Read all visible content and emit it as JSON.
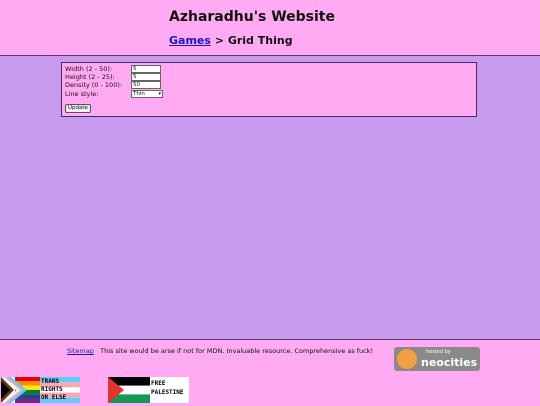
{
  "header": {
    "site_title": "Azharadhu's Website",
    "breadcrumb": {
      "games_link": "Games",
      "separator": ">",
      "current": "Grid Thing"
    }
  },
  "form": {
    "width_label": "Width (2 - 50):",
    "width_value": "5",
    "height_label": "Height (2 - 25):",
    "height_value": "5",
    "density_label": "Density (0 - 100):",
    "density_value": "50",
    "line_style_label": "Line style:",
    "line_style_value": "Thin",
    "update_button": "Update"
  },
  "footer": {
    "sitemap_link": "Sitemap",
    "message": "This site would be arse if not for MDN. Invaluable resource. Comprehensive as fuck!",
    "neocities_badge_small": "hosted by",
    "neocities_badge_big": "neocities",
    "trans_badge": [
      "TRANS",
      "RIGHTS",
      "OR ELSE"
    ],
    "palestine_badge": [
      "FREE",
      "PALESTINE"
    ]
  },
  "colors": {
    "page_background": "#c89bf0",
    "header_footer_background": "#ffaaf2",
    "link": "#1a16c8"
  }
}
